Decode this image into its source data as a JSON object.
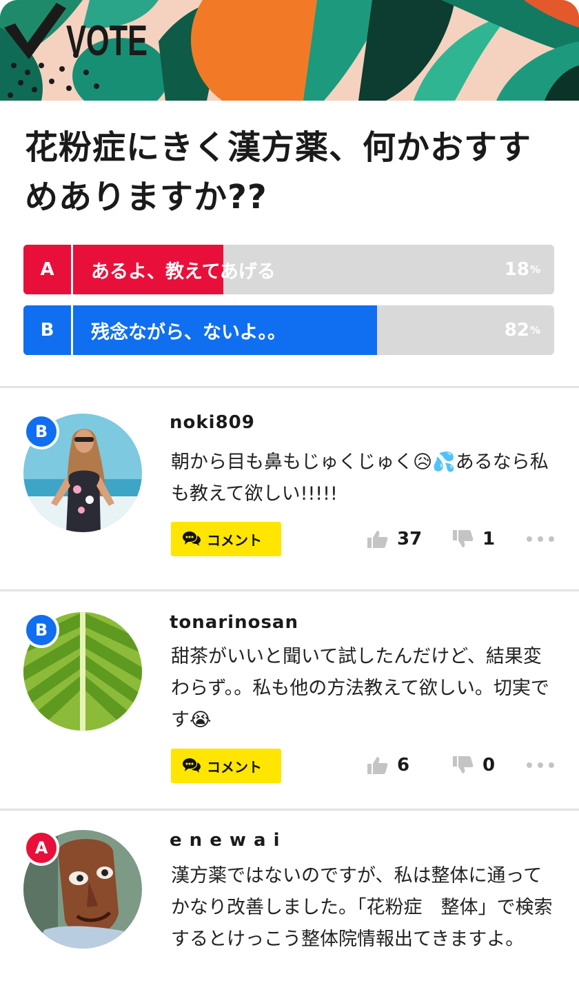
{
  "banner": {
    "logo_text": "VOTE"
  },
  "question": "花粉症にきく漢方薬、何かおすすめありますか??",
  "poll": {
    "options": [
      {
        "letter": "A",
        "label": "あるよ、教えてあげる",
        "percent": 18,
        "pct_text": "18",
        "pct_unit": "%",
        "color": "#e8103a"
      },
      {
        "letter": "B",
        "label": "残念ながら、ないよ。。",
        "percent": 82,
        "pct_text": "82",
        "pct_unit": "%",
        "color": "#0f6ff0"
      }
    ]
  },
  "comments": [
    {
      "choice": "B",
      "username": "noki809",
      "text": "朝から目も鼻もじゅくじゅく😥💦あるなら私も教えて欲しい!!!!!",
      "comment_label": "コメント",
      "likes": "37",
      "dislikes": "1"
    },
    {
      "choice": "B",
      "username": "tonarinosan",
      "text": "甜茶がいいと聞いて試したんだけど、結果変わらず。。私も他の方法教えて欲しい。切実です😭",
      "comment_label": "コメント",
      "likes": "6",
      "dislikes": "0"
    },
    {
      "choice": "A",
      "username": "e n e w a i",
      "text": "漢方薬ではないのですが、私は整体に通ってかなり改善しました。「花粉症　整体」で検索するとけっこう整体院情報出てきますよ。"
    }
  ],
  "colors": {
    "choice_a": "#e8103a",
    "choice_b": "#0f6ff0",
    "comment_button": "#ffe500",
    "bar_track": "#d9d9d9"
  },
  "icons": {
    "comment": "speech-bubble-icon",
    "like": "thumbs-up-icon",
    "dislike": "thumbs-down-icon",
    "more": "more-dots-icon"
  }
}
